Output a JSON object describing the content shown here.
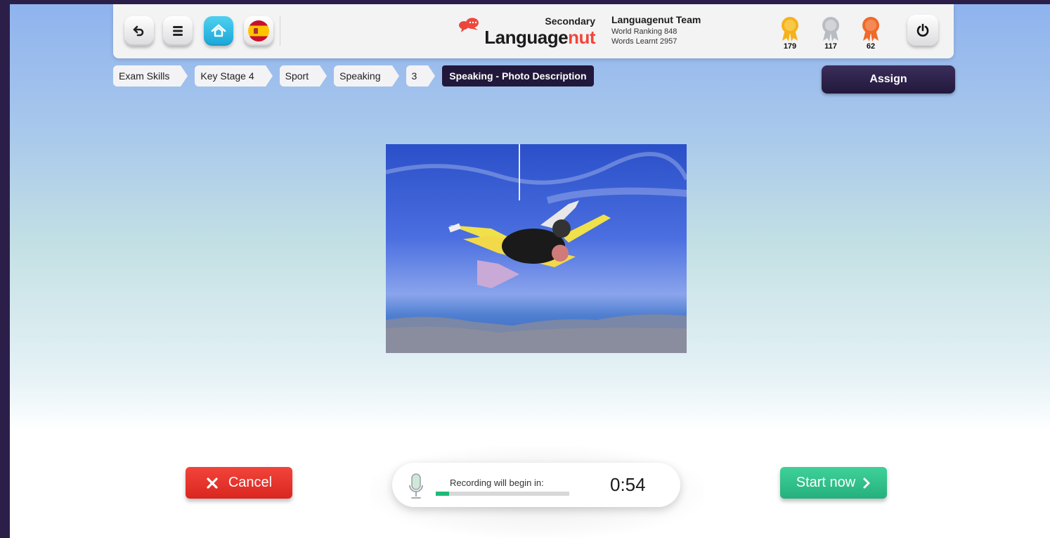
{
  "topbar": {
    "buttons": {
      "back": "back-arrow-icon",
      "menu": "menu-icon",
      "home": "home-icon",
      "language": "spain-flag-icon"
    },
    "logo": {
      "tier": "Secondary",
      "brand_prefix": "Language",
      "brand_suffix": "nut"
    },
    "team": {
      "name": "Languagenut Team",
      "ranking": "World Ranking 848",
      "words": "Words Learnt 2957"
    },
    "medals": [
      {
        "kind": "gold",
        "count": "179",
        "color": "#f5b21a"
      },
      {
        "kind": "silver",
        "count": "117",
        "color": "#b9bcc2"
      },
      {
        "kind": "bronze",
        "count": "62",
        "color": "#f06a2a"
      }
    ],
    "power_icon": "power-icon"
  },
  "breadcrumb": [
    "Exam Skills",
    "Key Stage 4",
    "Sport",
    "Speaking",
    "3"
  ],
  "breadcrumb_active": "Speaking - Photo Description",
  "assign_label": "Assign",
  "photo_alt": "Tandem skydivers in free fall above coastline",
  "cancel_label": "Cancel",
  "start_label": "Start now",
  "recording": {
    "label": "Recording will begin in:",
    "time": "0:54",
    "progress": 0.1
  },
  "colors": {
    "accent_dark": "#22183b",
    "cancel": "#e33a30",
    "start": "#2fc08a",
    "brand_red": "#f0473a"
  }
}
